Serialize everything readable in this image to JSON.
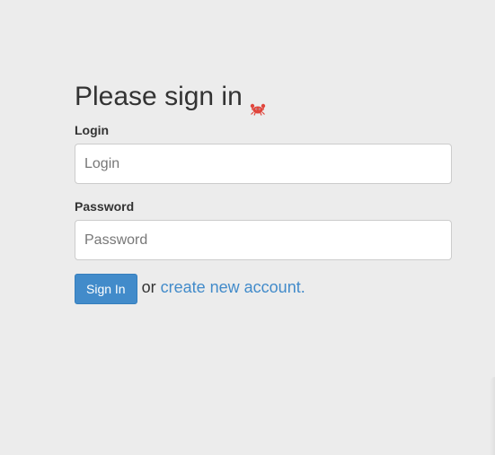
{
  "heading": {
    "title": "Please sign in",
    "icon": "crab-icon"
  },
  "login": {
    "label": "Login",
    "placeholder": "Login",
    "value": ""
  },
  "password": {
    "label": "Password",
    "placeholder": "Password",
    "value": ""
  },
  "actions": {
    "signin_label": "Sign In",
    "or_text": "or",
    "create_link_text": "create new account."
  },
  "colors": {
    "background": "#ececec",
    "primary": "#428bca",
    "link": "#428bca",
    "text": "#333333",
    "crab": "#e0453c"
  }
}
